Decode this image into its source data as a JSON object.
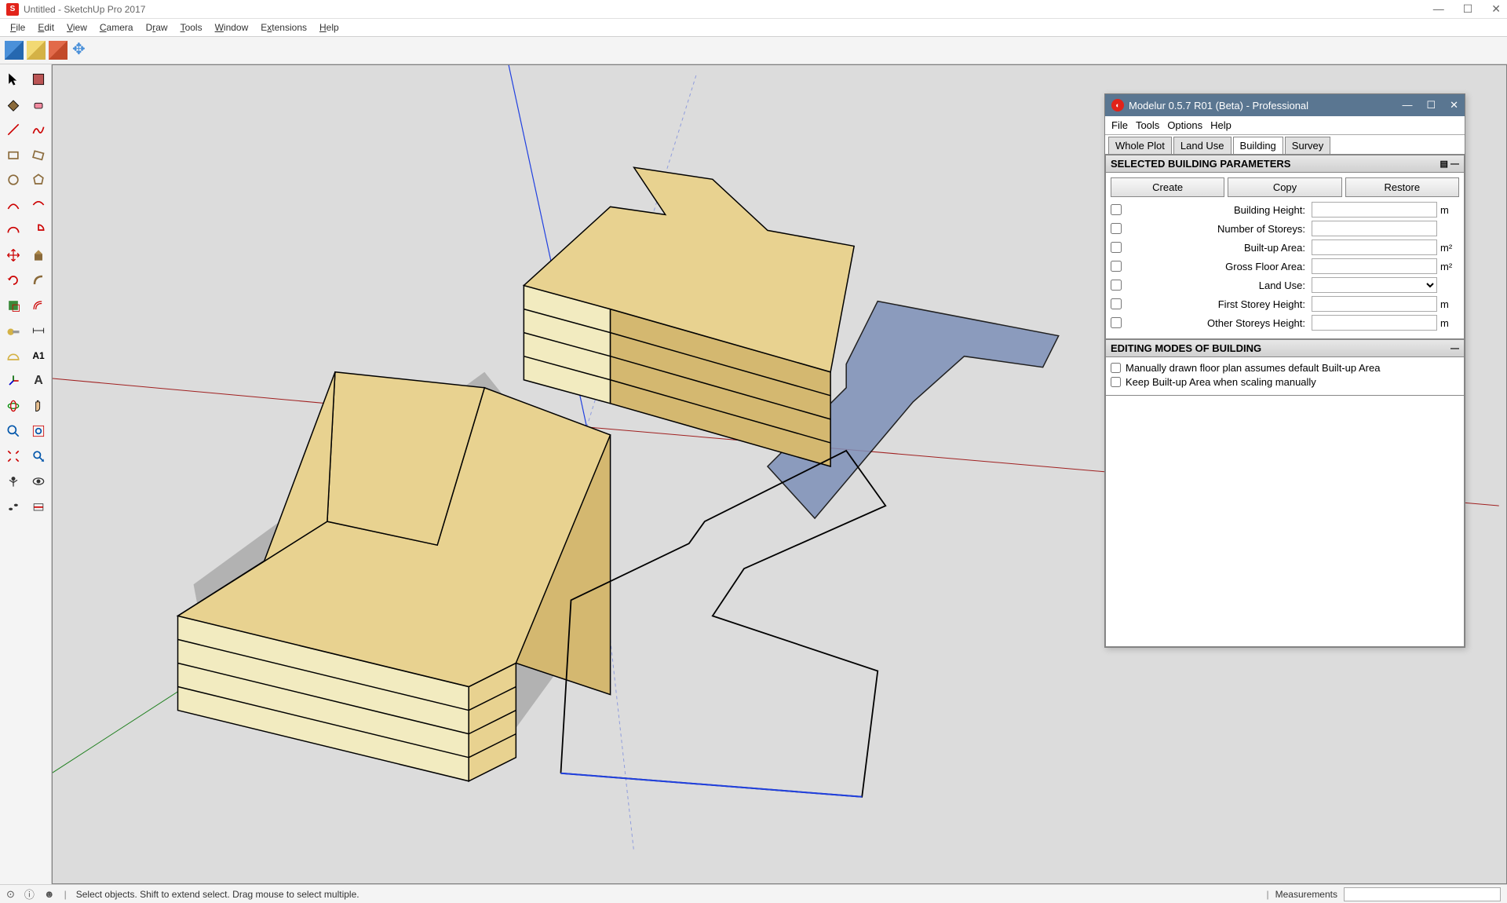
{
  "window": {
    "title": "Untitled - SketchUp Pro 2017"
  },
  "menubar": [
    "File",
    "Edit",
    "View",
    "Camera",
    "Draw",
    "Tools",
    "Window",
    "Extensions",
    "Help"
  ],
  "statusbar": {
    "hint": "Select objects. Shift to extend select. Drag mouse to select multiple.",
    "measurements_label": "Measurements"
  },
  "modelur": {
    "title": "Modelur 0.5.7 R01 (Beta) - Professional",
    "menu": [
      "File",
      "Tools",
      "Options",
      "Help"
    ],
    "tabs": [
      "Whole Plot",
      "Land Use",
      "Building",
      "Survey"
    ],
    "active_tab": "Building",
    "section1_title": "SELECTED BUILDING PARAMETERS",
    "buttons": {
      "create": "Create",
      "copy": "Copy",
      "restore": "Restore"
    },
    "fields": {
      "building_height": {
        "label": "Building Height:",
        "unit": "m"
      },
      "num_storeys": {
        "label": "Number of Storeys:",
        "unit": ""
      },
      "builtup_area": {
        "label": "Built-up Area:",
        "unit": "m²"
      },
      "gross_floor": {
        "label": "Gross Floor Area:",
        "unit": "m²"
      },
      "land_use": {
        "label": "Land Use:",
        "unit": ""
      },
      "first_storey": {
        "label": "First Storey Height:",
        "unit": "m"
      },
      "other_storeys": {
        "label": "Other Storeys Height:",
        "unit": "m"
      }
    },
    "section2_title": "EDITING MODES OF BUILDING",
    "check1": "Manually drawn floor plan assumes default Built-up Area",
    "check2": "Keep Built-up Area when scaling manually"
  }
}
